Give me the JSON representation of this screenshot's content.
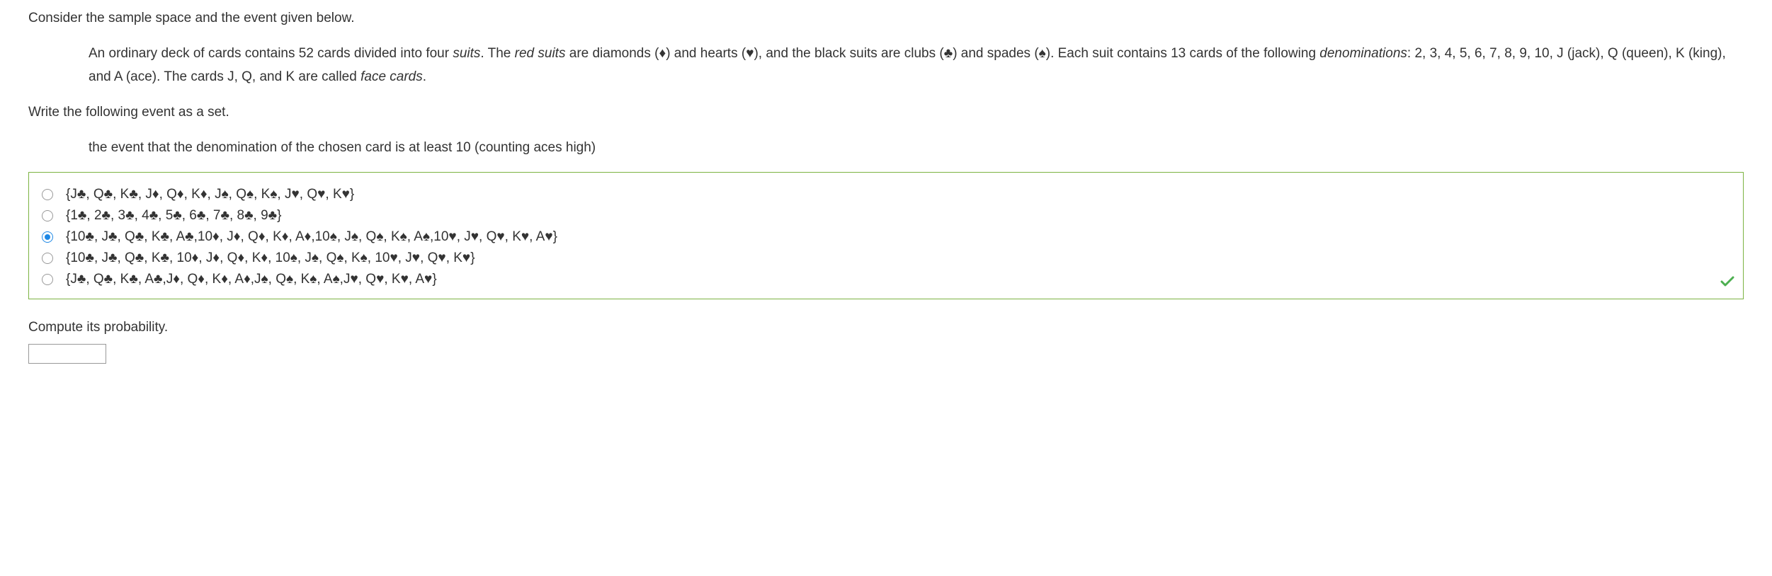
{
  "intro": "Consider the sample space and the event given below.",
  "deck_description": {
    "part1": "An ordinary deck of cards contains 52 cards divided into four ",
    "suits": "suits",
    "part2": ". The ",
    "red_suits": "red suits",
    "part3": " are diamonds (",
    "diamond": "♦",
    "part4": ") and hearts (",
    "heart": "♥",
    "part5": "), and the black suits are clubs (",
    "club": "♣",
    "part6": ") and spades (",
    "spade": "♠",
    "part7": "). Each suit contains 13 cards of the following ",
    "denominations": "denominations",
    "part8": ": 2, 3, 4, 5, 6, 7, 8, 9, 10, J (jack), Q (queen), K (king), and A (ace). The cards J, Q, and K are called ",
    "face_cards": "face cards",
    "part9": "."
  },
  "instruction": "Write the following event as a set.",
  "event_description": "the event that the denomination of the chosen card is at least 10 (counting aces high)",
  "options": [
    {
      "text": "{J♣, Q♣, K♣, J♦, Q♦, K♦, J♠, Q♠, K♠, J♥, Q♥, K♥}",
      "selected": false
    },
    {
      "text": "{1♣, 2♣, 3♣, 4♣, 5♣, 6♣, 7♣, 8♣, 9♣}",
      "selected": false
    },
    {
      "text": "{10♣, J♣, Q♣, K♣, A♣,10♦, J♦, Q♦, K♦, A♦,10♠, J♠, Q♠, K♠, A♠,10♥, J♥, Q♥, K♥, A♥}",
      "selected": true
    },
    {
      "text": "{10♣, J♣, Q♣, K♣, 10♦, J♦, Q♦, K♦, 10♠, J♠, Q♠, K♠, 10♥, J♥, Q♥, K♥}",
      "selected": false
    },
    {
      "text": "{J♣, Q♣, K♣, A♣,J♦, Q♦, K♦, A♦,J♠, Q♠, K♠, A♠,J♥, Q♥, K♥, A♥}",
      "selected": false
    }
  ],
  "compute_prompt": "Compute its probability."
}
